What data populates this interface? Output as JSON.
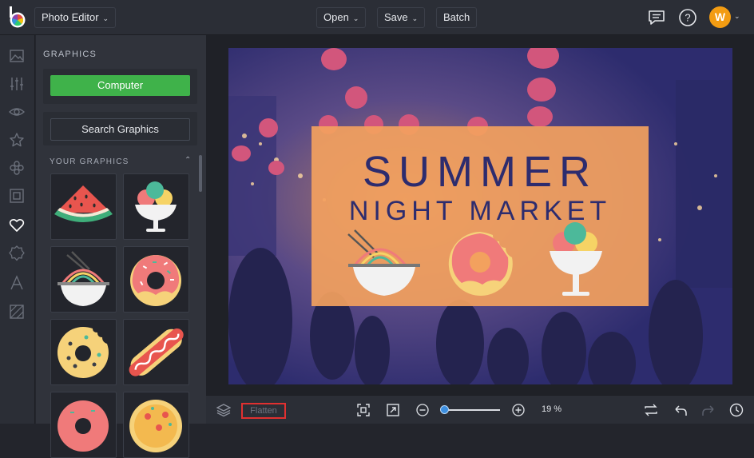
{
  "header": {
    "app_menu_label": "Photo Editor",
    "open_label": "Open",
    "save_label": "Save",
    "batch_label": "Batch",
    "avatar_initial": "W"
  },
  "rail": {
    "icons": [
      "image-icon",
      "sliders-icon",
      "eye-icon",
      "star-icon",
      "effects-icon",
      "frame-icon",
      "heart-icon",
      "badge-icon",
      "text-icon",
      "texture-icon"
    ]
  },
  "panel": {
    "title": "GRAPHICS",
    "computer_label": "Computer",
    "search_label": "Search Graphics",
    "your_graphics_label": "YOUR GRAPHICS",
    "graphics": [
      "watermelon",
      "ice-cream",
      "ramen-bowl",
      "pink-donut",
      "bitten-donut",
      "hot-dog",
      "donut",
      "pizza"
    ]
  },
  "canvas": {
    "title_line1": "SUMMER",
    "title_line2": "NIGHT MARKET",
    "colors": {
      "overlay": "#f3a15e",
      "text": "#2d2c6e",
      "scene": "#2d2c6e"
    }
  },
  "bottombar": {
    "flatten_label": "Flatten",
    "zoom_level": "19 %"
  }
}
